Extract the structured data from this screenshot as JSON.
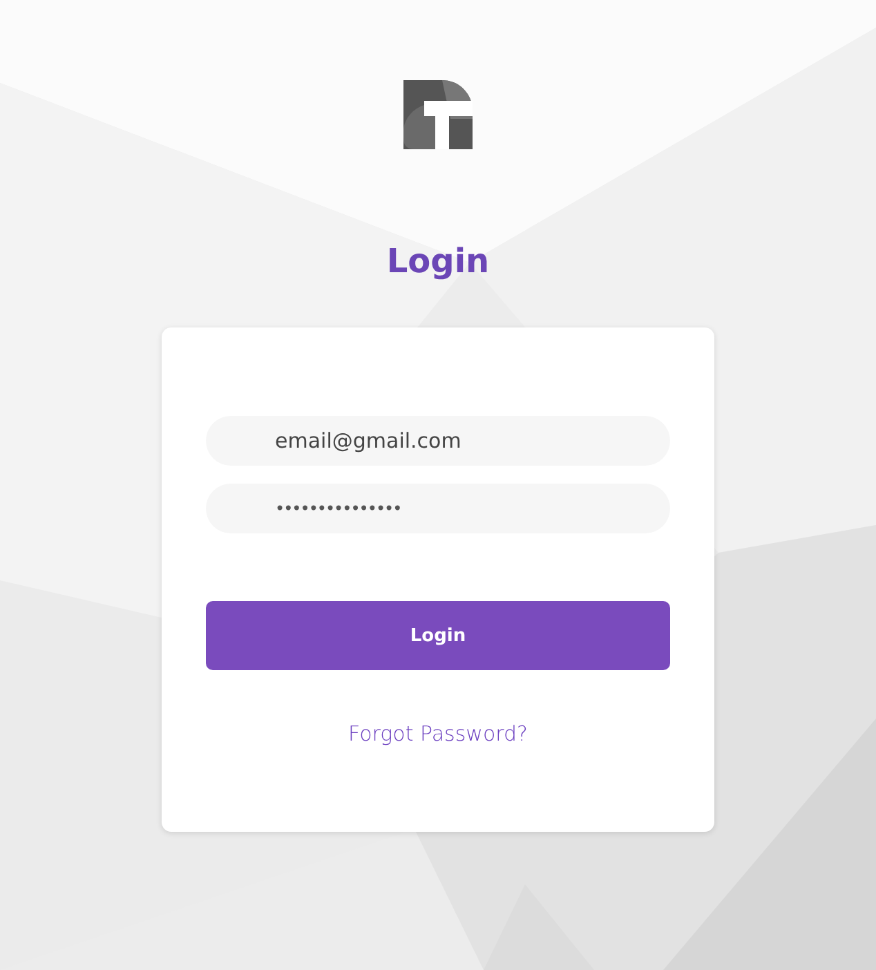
{
  "title": "Login",
  "fields": [
    {
      "kind": "email",
      "value": "email@gmail.com"
    },
    {
      "kind": "password",
      "value": "•••••••••••••••"
    }
  ],
  "button": "Login",
  "link": "Forgot Password?"
}
